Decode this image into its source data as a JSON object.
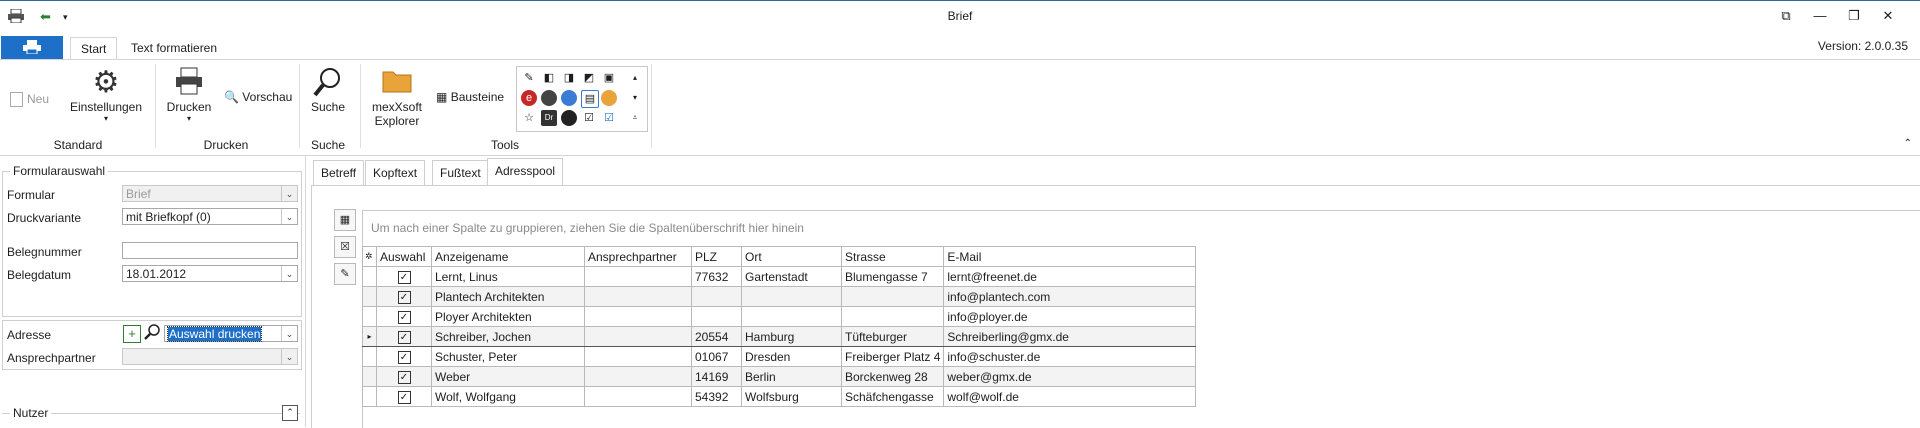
{
  "window": {
    "title": "Brief"
  },
  "ribbon": {
    "file_label": "",
    "tabs": [
      {
        "label": "Start"
      },
      {
        "label": "Text formatieren"
      }
    ],
    "version": "Version: 2.0.0.35",
    "groups": {
      "standard": {
        "label": "Standard",
        "neu": "Neu",
        "einstellungen": "Einstellungen"
      },
      "drucken": {
        "label": "Drucken",
        "drucken": "Drucken",
        "vorschau": "Vorschau"
      },
      "suche": {
        "label": "Suche",
        "suche": "Suche"
      },
      "tools": {
        "label": "Tools",
        "explorer_l1": "mexXsoft",
        "explorer_l2": "Explorer",
        "bausteine": "Bausteine"
      }
    }
  },
  "left_panel": {
    "section_title": "Formularauswahl",
    "formular_label": "Formular",
    "formular_value": "Brief",
    "druckvariante_label": "Druckvariante",
    "druckvariante_value": "mit Briefkopf (0)",
    "belegnummer_label": "Belegnummer",
    "belegnummer_value": "",
    "belegdatum_label": "Belegdatum",
    "belegdatum_value": "18.01.2012",
    "adresse_label": "Adresse",
    "adresse_value": "Auswahl drucken",
    "ansprechpartner_label": "Ansprechpartner",
    "ansprechpartner_value": "",
    "nutzer_title": "Nutzer"
  },
  "doc_tabs": [
    {
      "label": "Betreff"
    },
    {
      "label": "Kopftext"
    },
    {
      "label": "Fußtext"
    },
    {
      "label": "Adresspool"
    }
  ],
  "grid": {
    "group_hint": "Um nach einer Spalte zu gruppieren, ziehen Sie die Spaltenüberschrift hier hinein",
    "columns": [
      "Auswahl",
      "Anzeigename",
      "Ansprechpartner",
      "PLZ",
      "Ort",
      "Strasse",
      "E-Mail"
    ],
    "rows": [
      {
        "auswahl": "✓",
        "name": "Lernt, Linus",
        "ansprech": "",
        "plz": "77632",
        "ort": "Gartenstadt",
        "strasse": "Blumengasse 7",
        "email": "lernt@freenet.de"
      },
      {
        "auswahl": "✓",
        "name": "Plantech Architekten",
        "ansprech": "",
        "plz": "",
        "ort": "",
        "strasse": "",
        "email": "info@plantech.com"
      },
      {
        "auswahl": "✓",
        "name": "Ployer Architekten",
        "ansprech": "",
        "plz": "",
        "ort": "",
        "strasse": "",
        "email": "info@ployer.de"
      },
      {
        "auswahl": "✓",
        "name": "Schreiber, Jochen",
        "ansprech": "",
        "plz": "20554",
        "ort": "Hamburg",
        "strasse": "Tüfteburger",
        "email": "Schreiberling@gmx.de"
      },
      {
        "auswahl": "✓",
        "name": "Schuster, Peter",
        "ansprech": "",
        "plz": "01067",
        "ort": "Dresden",
        "strasse": "Freiberger Platz 4",
        "email": "info@schuster.de"
      },
      {
        "auswahl": "✓",
        "name": "Weber",
        "ansprech": "",
        "plz": "14169",
        "ort": "Berlin",
        "strasse": "Borckenweg 28",
        "email": "weber@gmx.de"
      },
      {
        "auswahl": "✓",
        "name": "Wolf, Wolfgang",
        "ansprech": "",
        "plz": "54392",
        "ort": "Wolfsburg",
        "strasse": "Schäfchengasse",
        "email": "wolf@wolf.de"
      }
    ]
  },
  "colors": {
    "accent": "#1e6fc8",
    "selection": "#1e6fc8"
  }
}
